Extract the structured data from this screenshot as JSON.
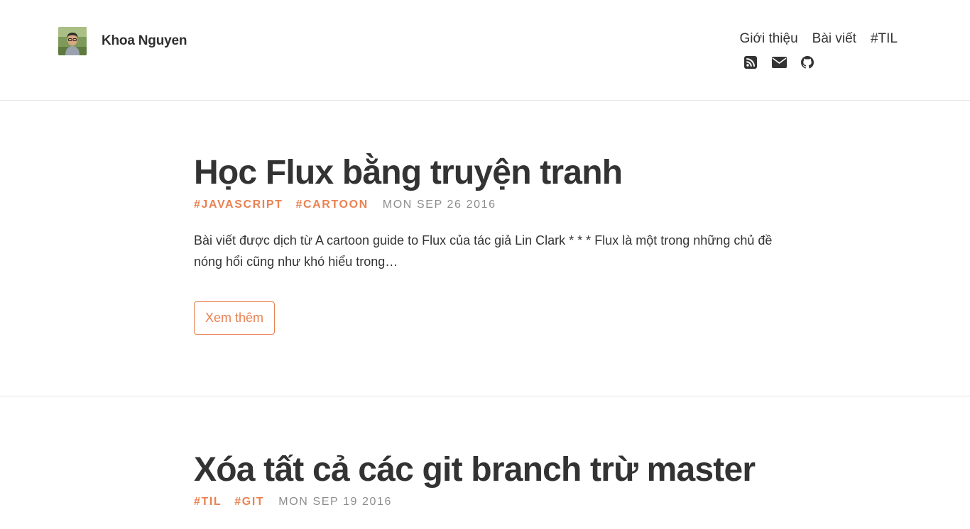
{
  "header": {
    "site_name": "Khoa Nguyen",
    "nav": [
      {
        "label": "Giới thiệu"
      },
      {
        "label": "Bài viết"
      },
      {
        "label": "#TIL"
      }
    ],
    "social": [
      {
        "icon": "rss-icon"
      },
      {
        "icon": "envelope-icon"
      },
      {
        "icon": "github-icon"
      }
    ]
  },
  "posts": [
    {
      "title": "Học Flux bằng truyện tranh",
      "tags": [
        "#JAVASCRIPT",
        "#CARTOON"
      ],
      "date": "MON SEP 26 2016",
      "excerpt": "Bài viết được dịch từ A cartoon guide to Flux của tác giả Lin Clark * * * Flux là một trong những chủ đề nóng hổi cũng như khó hiểu trong…",
      "read_more": "Xem thêm"
    },
    {
      "title": "Xóa tất cả các git branch trừ master",
      "tags": [
        "#TIL",
        "#GIT"
      ],
      "date": "MON SEP 19 2016"
    }
  ],
  "colors": {
    "accent": "#ea8151",
    "text": "#333333",
    "muted": "#8c8c8c",
    "divider": "#e6e6e6"
  }
}
